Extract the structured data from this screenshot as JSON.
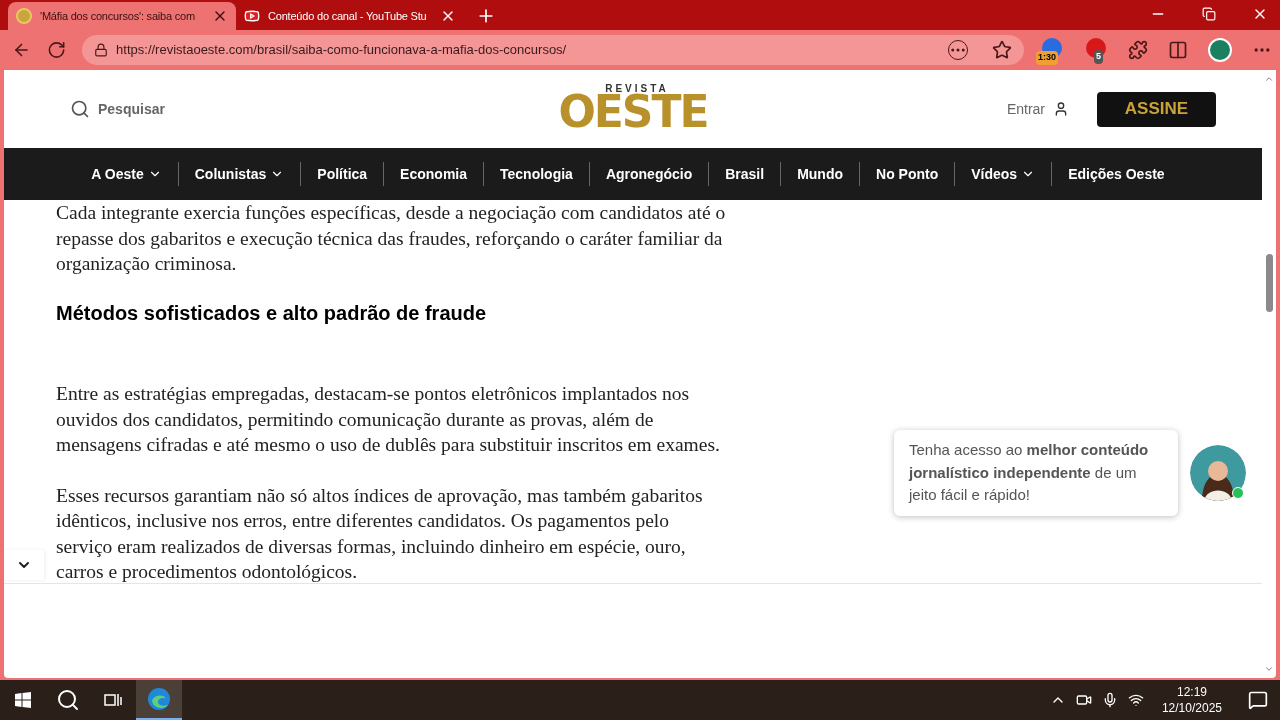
{
  "tabs": [
    {
      "title": "'Máfia dos concursos': saiba com",
      "selected": true,
      "kind": "site"
    },
    {
      "title": "Conteúdo do canal - YouTube Stu",
      "selected": false,
      "kind": "video"
    }
  ],
  "address_bar": {
    "url": "https://revistaoeste.com/brasil/saiba-como-funcionava-a-mafia-dos-concursos/"
  },
  "extensions": [
    {
      "badge": "1:30"
    },
    {
      "badge": "5"
    }
  ],
  "header": {
    "search_label": "Pesquisar",
    "logo_top": "REVISTA",
    "logo_main": "OESTE",
    "login": "Entrar",
    "subscribe": "ASSINE"
  },
  "nav": [
    {
      "label": "A Oeste",
      "has_menu": true
    },
    {
      "label": "Colunistas",
      "has_menu": true
    },
    {
      "label": "Política",
      "has_menu": false
    },
    {
      "label": "Economia",
      "has_menu": false
    },
    {
      "label": "Tecnologia",
      "has_menu": false
    },
    {
      "label": "Agronegócio",
      "has_menu": false
    },
    {
      "label": "Brasil",
      "has_menu": false
    },
    {
      "label": "Mundo",
      "has_menu": false
    },
    {
      "label": "No Ponto",
      "has_menu": false
    },
    {
      "label": "Vídeos",
      "has_menu": true
    },
    {
      "label": "Edições Oeste",
      "has_menu": false
    }
  ],
  "article": [
    {
      "kind": "paragraph",
      "lines": [
        "Cada integrante exercia funções específicas, desde a negociação com candidatos até o",
        "repasse dos gabaritos e execução técnica das fraudes, reforçando o caráter familiar da",
        "organização criminosa."
      ]
    },
    {
      "kind": "heading",
      "lines": [
        "Métodos sofisticados e alto padrão de fraude"
      ]
    },
    {
      "kind": "paragraph",
      "lines": [
        "Entre as estratégias empregadas, destacam-se pontos eletrônicos implantados nos",
        "ouvidos dos candidatos, permitindo comunicação durante as provas, além de",
        "mensagens cifradas e até mesmo o uso de dublês para substituir inscritos em exames."
      ]
    },
    {
      "kind": "paragraph",
      "lines": [
        "Esses recursos garantiam não só altos índices de aprovação, mas também gabaritos",
        "idênticos, inclusive nos erros, entre diferentes candidatos. Os pagamentos pelo",
        "serviço eram realizados de diversas formas, incluindo dinheiro em espécie, ouro,",
        "carros e procedimentos odontológicos."
      ]
    }
  ],
  "promo": {
    "text": "Tenha acesso ao **melhor conteúdo jornalístico independente** de um jeito fácil e rápido!",
    "online": true
  },
  "taskbar": {
    "time": "12:19",
    "date": "12/10/2025"
  }
}
